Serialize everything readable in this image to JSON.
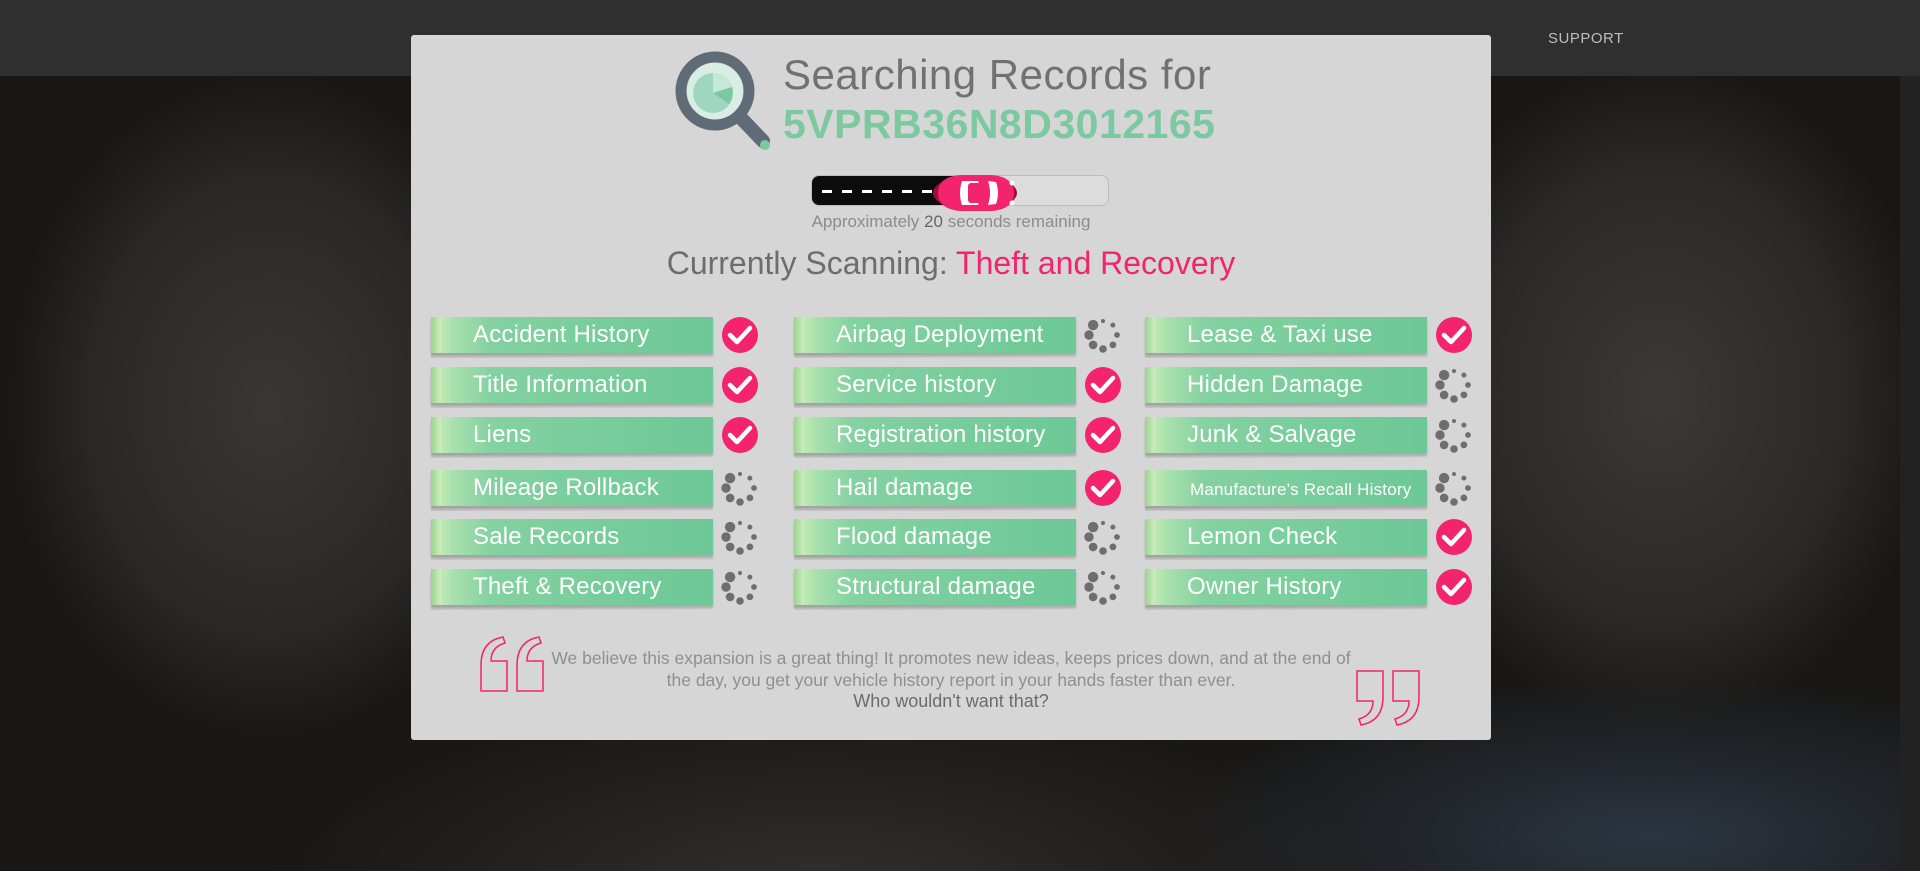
{
  "background": {
    "nav_partial": [
      "",
      "",
      "",
      ""
    ],
    "support_label": "SUPPORT"
  },
  "modal": {
    "title_prefix": "Searching Records for",
    "vin": "5VPRB36N8D3012165",
    "progress": {
      "fraction": 0.48,
      "remaining_prefix": "Approximately",
      "seconds": "20",
      "remaining_suffix": "seconds remaining"
    },
    "scanning_label": "Currently Scanning:",
    "scanning_item": "Theft and Recovery",
    "checks": {
      "columns": [
        [
          {
            "label": "Accident History",
            "status": "done"
          },
          {
            "label": "Title Information",
            "status": "done"
          },
          {
            "label": "Liens",
            "status": "done"
          },
          {
            "label": "Mileage Rollback",
            "status": "pending"
          },
          {
            "label": "Sale Records",
            "status": "pending"
          },
          {
            "label": "Theft & Recovery",
            "status": "pending"
          }
        ],
        [
          {
            "label": "Airbag Deployment",
            "status": "pending"
          },
          {
            "label": "Service history",
            "status": "done"
          },
          {
            "label": "Registration history",
            "status": "done"
          },
          {
            "label": "Hail damage",
            "status": "done"
          },
          {
            "label": "Flood damage",
            "status": "pending"
          },
          {
            "label": "Structural damage",
            "status": "pending"
          }
        ],
        [
          {
            "label": "Lease & Taxi use",
            "status": "done"
          },
          {
            "label": "Hidden Damage",
            "status": "pending"
          },
          {
            "label": "Junk & Salvage",
            "status": "pending"
          },
          {
            "label": "Manufacture's Recall History",
            "status": "pending",
            "small": true
          },
          {
            "label": "Lemon Check",
            "status": "done"
          },
          {
            "label": "Owner History",
            "status": "done"
          }
        ]
      ]
    },
    "testimonial": {
      "text": "We believe this expansion is a great thing! It promotes new ideas, keeps prices down, and at the end of the day, you get your vehicle history report in your hands faster than ever.",
      "tagline": "Who wouldn't want that?"
    }
  },
  "colors": {
    "accent_pink": "#f3246c",
    "vin_green": "#7cc9a0",
    "ribbon_green": "#6cc896",
    "modal_bg": "#d6d6d6"
  },
  "icons": {
    "done": "check-circle-icon",
    "pending": "spinner-icon"
  }
}
